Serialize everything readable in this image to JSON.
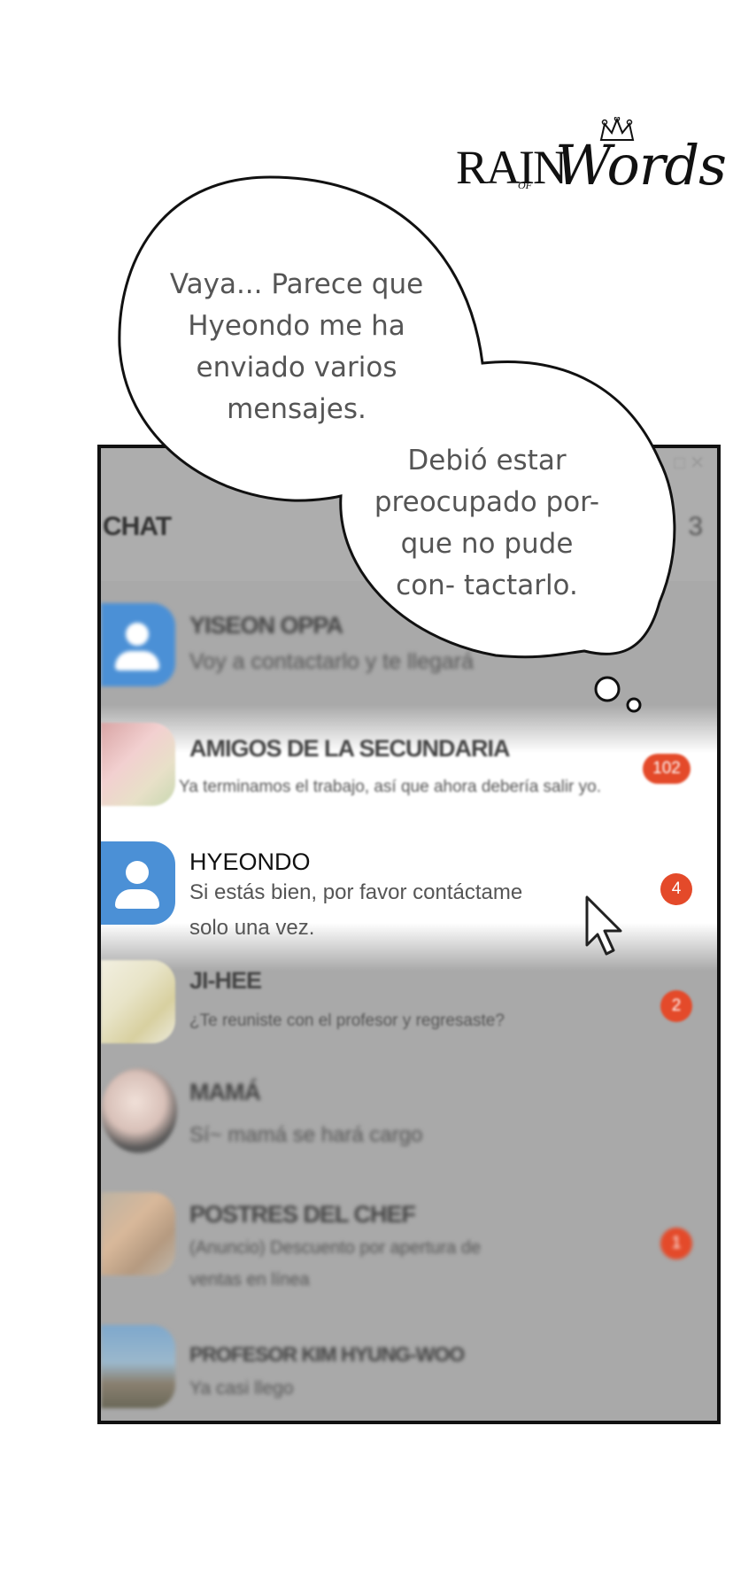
{
  "logo": {
    "line1": "RAIN",
    "line2": "OF",
    "line3": "Words"
  },
  "bubbles": {
    "first": "Vaya... Parece que Hyeondo me ha enviado varios mensajes.",
    "second": "Debió estar preocupado por- que no pude con- tactarlo."
  },
  "phone": {
    "header_title": "CHAT",
    "header_count": "3",
    "chats": [
      {
        "name": "YISEON OPPA",
        "message": "Voy a contactarlo y te llegará",
        "badge": ""
      },
      {
        "name": "AMIGOS DE LA SECUNDARIA",
        "message": "Ya terminamos el trabajo, así que ahora debería salir yo.",
        "badge": "102"
      },
      {
        "name": "HYEONDO",
        "message_line1": "Si estás bien, por favor contáctame",
        "message_line2": "solo una vez.",
        "badge": "4"
      },
      {
        "name": "JI-HEE",
        "message": "¿Te reuniste con el profesor y regresaste?",
        "badge": "2"
      },
      {
        "name": "MAMÁ",
        "message": "Sí~ mamá se hará cargo",
        "badge": ""
      },
      {
        "name": "POSTRES DEL CHEF",
        "message_line1": "(Anuncio) Descuento por apertura de",
        "message_line2": "ventas en línea",
        "badge": "1"
      },
      {
        "name": "PROFESOR KIM HYUNG-WOO",
        "message": "Ya casi llego",
        "badge": ""
      }
    ]
  },
  "colors": {
    "badge": "#e44a2a",
    "avatar_blue": "#4b90d6",
    "dimmed_bg": "#a9a9a9"
  }
}
